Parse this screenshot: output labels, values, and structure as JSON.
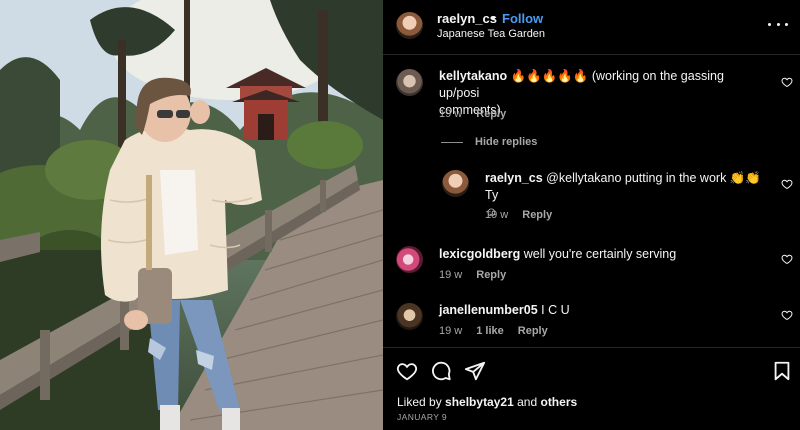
{
  "post": {
    "username": "raelyn_cs",
    "separator": "•",
    "follow_label": "Follow",
    "location": "Japanese Tea Garden"
  },
  "comments": [
    {
      "username": "kellytakano",
      "text": "🔥🔥🔥🔥🔥 (working on the gassing up/posi",
      "text_line2": "comments)",
      "time": "19 w",
      "reply_label": "Reply"
    },
    {
      "username": "lexicgoldberg",
      "text": "well you're certainly serving",
      "time": "19 w",
      "reply_label": "Reply"
    },
    {
      "username": "janellenumber05",
      "text": "I C U",
      "time": "19 w",
      "likes": "1 like",
      "reply_label": "Reply"
    }
  ],
  "hide_replies_label": "Hide replies",
  "reply": {
    "username": "raelyn_cs",
    "text": "@kellytakano putting in the work 👏👏 Ty",
    "text_line2": "☺",
    "time": "19 w",
    "reply_label": "Reply"
  },
  "footer": {
    "liked_prefix": "Liked by",
    "liked_user": "shelbytay21",
    "liked_and": "and",
    "liked_others": "others",
    "date": "JANUARY 9"
  },
  "colors": {
    "follow": "#4a9cf0",
    "background": "#000000",
    "muted": "#a8a8a8"
  },
  "icons": [
    "more-icon",
    "heart-icon",
    "comment-icon",
    "share-icon",
    "bookmark-icon"
  ]
}
